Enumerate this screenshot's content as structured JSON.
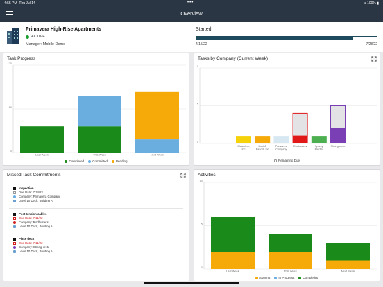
{
  "status_bar": {
    "time": "4:55 PM",
    "date": "Thu Jul 14",
    "battery": "100%"
  },
  "nav": {
    "title": "Overview"
  },
  "project": {
    "name": "Primavera High-Rise Apartments",
    "status": "ACTIVE",
    "manager": "Manager: Mobile Demo",
    "started_label": "Started",
    "start_date": "4/15/22",
    "end_date": "7/28/22",
    "progress": 0.87,
    "colors": {
      "progress": "#1e4a5e",
      "active": "#1a9e2e"
    }
  },
  "task_progress": {
    "title": "Task Progress",
    "legend": [
      "Completed",
      "Committed",
      "Pending"
    ],
    "colors": {
      "Completed": "#1a8a1a",
      "Committed": "#6aaee0",
      "Pending": "#f5aa0a"
    }
  },
  "tasks_by_company": {
    "title": "Tasks by Company (Current Week)",
    "legend": [
      "Remaining Due"
    ]
  },
  "missed": {
    "title": "Missed Task Commitments",
    "items": [
      {
        "title": "Inspection",
        "due": "Due Date: 7/14/22",
        "company": "Company: Primavera Company",
        "location": "Level 10 Deck, Building A",
        "due_color": "#555555",
        "company_color": "#6aaee0"
      },
      {
        "title": "Post tension cables",
        "due": "Due Date: 7/11/22",
        "company": "Company: Rodbusters",
        "location": "Level 10 Deck, Building A",
        "due_color": "#d21f1f",
        "company_color": "#d21f1f"
      },
      {
        "title": "Place deck",
        "due": "Due Date: 7/11/22",
        "company": "Company: Strong-crete",
        "location": "Level 10 Deck, Building A",
        "due_color": "#d21f1f",
        "company_color": "#7a3fb5"
      }
    ]
  },
  "activities": {
    "title": "Activities",
    "legend": [
      "Starting",
      "In Progress",
      "Completing"
    ],
    "colors": {
      "Starting": "#f5aa0a",
      "In Progress": "#6aaee0",
      "Completing": "#1a8a1a"
    }
  },
  "chart_data": [
    {
      "type": "bar",
      "title": "Task Progress",
      "stacked": true,
      "categories": [
        "Last Week",
        "This Week",
        "Next Week"
      ],
      "series": [
        {
          "name": "Completed",
          "values": [
            6,
            6,
            0
          ]
        },
        {
          "name": "Committed",
          "values": [
            0,
            7,
            3
          ]
        },
        {
          "name": "Pending",
          "values": [
            0,
            0,
            11
          ]
        }
      ],
      "ylim": [
        0,
        20
      ],
      "yticks": [
        0,
        10,
        20
      ],
      "grid": true,
      "legend": "bottom"
    },
    {
      "type": "bar",
      "title": "Tasks by Company (Current Week)",
      "categories": [
        "Clearview, Inc",
        "Duct & Faucet, Inc",
        "Primavera Company",
        "Rodbusters",
        "Sparky Electric",
        "Strong-crete"
      ],
      "bars": [
        {
          "value": 1,
          "remaining": 0,
          "color": "#f5d20a",
          "border": "#f5d20a"
        },
        {
          "value": 1,
          "remaining": 0,
          "color": "#f5aa0a",
          "border": "#f5aa0a"
        },
        {
          "value": 1,
          "remaining": 0,
          "color": "#d8e8f2",
          "border": "#6aaee0"
        },
        {
          "value": 1,
          "remaining": 3,
          "color": "#e01818",
          "border": "#e01818"
        },
        {
          "value": 1,
          "remaining": 0,
          "color": "#4caf50",
          "border": "#4caf50"
        },
        {
          "value": 2,
          "remaining": 3,
          "color": "#7a3fb5",
          "border": "#7a3fb5"
        }
      ],
      "ylim": [
        0,
        10
      ],
      "yticks": [
        0,
        5,
        10
      ],
      "grid": true,
      "legend": "bottom"
    },
    {
      "type": "bar",
      "title": "Activities",
      "stacked": true,
      "categories": [
        "Last Week",
        "This Week",
        "Next Week"
      ],
      "series": [
        {
          "name": "Starting",
          "values": [
            2,
            2,
            1
          ]
        },
        {
          "name": "In Progress",
          "values": [
            0,
            0,
            0
          ]
        },
        {
          "name": "Completing",
          "values": [
            4,
            2,
            2
          ]
        }
      ],
      "ylim": [
        0,
        10
      ],
      "yticks": [
        0,
        5,
        10
      ],
      "grid": true,
      "legend": "bottom"
    }
  ]
}
